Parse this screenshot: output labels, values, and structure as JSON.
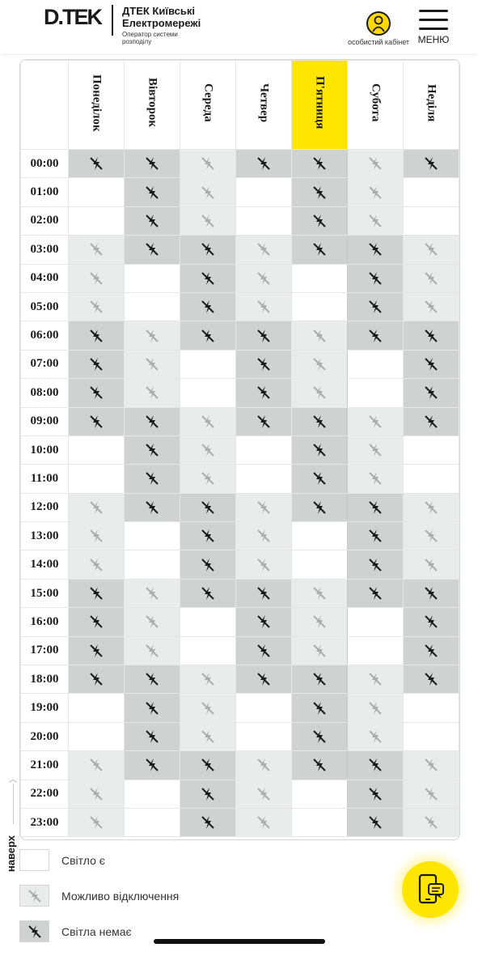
{
  "header": {
    "logo": "D.TEK",
    "brand_name": "ДТЕК Київські Електромережі",
    "brand_sub": "Оператор системи розподілу",
    "cabinet_label": "особистий кабінет",
    "menu_label": "МЕНЮ"
  },
  "schedule": {
    "days": [
      "Понеділок",
      "Вівторок",
      "Середа",
      "Четвер",
      "П'ятниця",
      "Субота",
      "Неділя"
    ],
    "today_index": 4,
    "rows": [
      {
        "time": "00:00",
        "cells": [
          "off",
          "off",
          "maybe",
          "off",
          "off",
          "maybe",
          "off"
        ]
      },
      {
        "time": "01:00",
        "cells": [
          "on",
          "off",
          "maybe",
          "on",
          "off",
          "maybe",
          "on"
        ]
      },
      {
        "time": "02:00",
        "cells": [
          "on",
          "off",
          "maybe",
          "on",
          "off",
          "maybe",
          "on"
        ]
      },
      {
        "time": "03:00",
        "cells": [
          "maybe",
          "off",
          "off",
          "maybe",
          "off",
          "off",
          "maybe"
        ]
      },
      {
        "time": "04:00",
        "cells": [
          "maybe",
          "on",
          "off",
          "maybe",
          "on",
          "off",
          "maybe"
        ]
      },
      {
        "time": "05:00",
        "cells": [
          "maybe",
          "on",
          "off",
          "maybe",
          "on",
          "off",
          "maybe"
        ]
      },
      {
        "time": "06:00",
        "cells": [
          "off",
          "maybe",
          "off",
          "off",
          "maybe",
          "off",
          "off"
        ]
      },
      {
        "time": "07:00",
        "cells": [
          "off",
          "maybe",
          "on",
          "off",
          "maybe",
          "on",
          "off"
        ]
      },
      {
        "time": "08:00",
        "cells": [
          "off",
          "maybe",
          "on",
          "off",
          "maybe",
          "on",
          "off"
        ]
      },
      {
        "time": "09:00",
        "cells": [
          "off",
          "off",
          "maybe",
          "off",
          "off",
          "maybe",
          "off"
        ]
      },
      {
        "time": "10:00",
        "cells": [
          "on",
          "off",
          "maybe",
          "on",
          "off",
          "maybe",
          "on"
        ]
      },
      {
        "time": "11:00",
        "cells": [
          "on",
          "off",
          "maybe",
          "on",
          "off",
          "maybe",
          "on"
        ]
      },
      {
        "time": "12:00",
        "cells": [
          "maybe",
          "off",
          "off",
          "maybe",
          "off",
          "off",
          "maybe"
        ]
      },
      {
        "time": "13:00",
        "cells": [
          "maybe",
          "on",
          "off",
          "maybe",
          "on",
          "off",
          "maybe"
        ]
      },
      {
        "time": "14:00",
        "cells": [
          "maybe",
          "on",
          "off",
          "maybe",
          "on",
          "off",
          "maybe"
        ]
      },
      {
        "time": "15:00",
        "cells": [
          "off",
          "maybe",
          "off",
          "off",
          "maybe",
          "off",
          "off"
        ]
      },
      {
        "time": "16:00",
        "cells": [
          "off",
          "maybe",
          "on",
          "off",
          "maybe",
          "on",
          "off"
        ]
      },
      {
        "time": "17:00",
        "cells": [
          "off",
          "maybe",
          "on",
          "off",
          "maybe",
          "on",
          "off"
        ]
      },
      {
        "time": "18:00",
        "cells": [
          "off",
          "off",
          "maybe",
          "off",
          "off",
          "maybe",
          "off"
        ]
      },
      {
        "time": "19:00",
        "cells": [
          "on",
          "off",
          "maybe",
          "on",
          "off",
          "maybe",
          "on"
        ]
      },
      {
        "time": "20:00",
        "cells": [
          "on",
          "off",
          "maybe",
          "on",
          "off",
          "maybe",
          "on"
        ]
      },
      {
        "time": "21:00",
        "cells": [
          "maybe",
          "off",
          "off",
          "maybe",
          "off",
          "off",
          "maybe"
        ]
      },
      {
        "time": "22:00",
        "cells": [
          "maybe",
          "on",
          "off",
          "maybe",
          "on",
          "off",
          "maybe"
        ]
      },
      {
        "time": "23:00",
        "cells": [
          "maybe",
          "on",
          "off",
          "maybe",
          "on",
          "off",
          "maybe"
        ]
      }
    ]
  },
  "legend": {
    "on": "Світло є",
    "maybe": "Можливо відключення",
    "off": "Світла немає"
  },
  "to_top_label": "наверх",
  "colors": {
    "accent": "#ffe600",
    "on": "#ffffff",
    "maybe": "#e9ecea",
    "off": "#cfd2d0",
    "icon_maybe": "#a9aeab",
    "icon_off": "#1a1a1a"
  },
  "icons": {
    "power_off": "no-power-icon",
    "power_maybe": "possible-outage-icon",
    "cabinet": "user-icon",
    "menu": "hamburger-icon",
    "chat": "phone-chat-icon"
  }
}
